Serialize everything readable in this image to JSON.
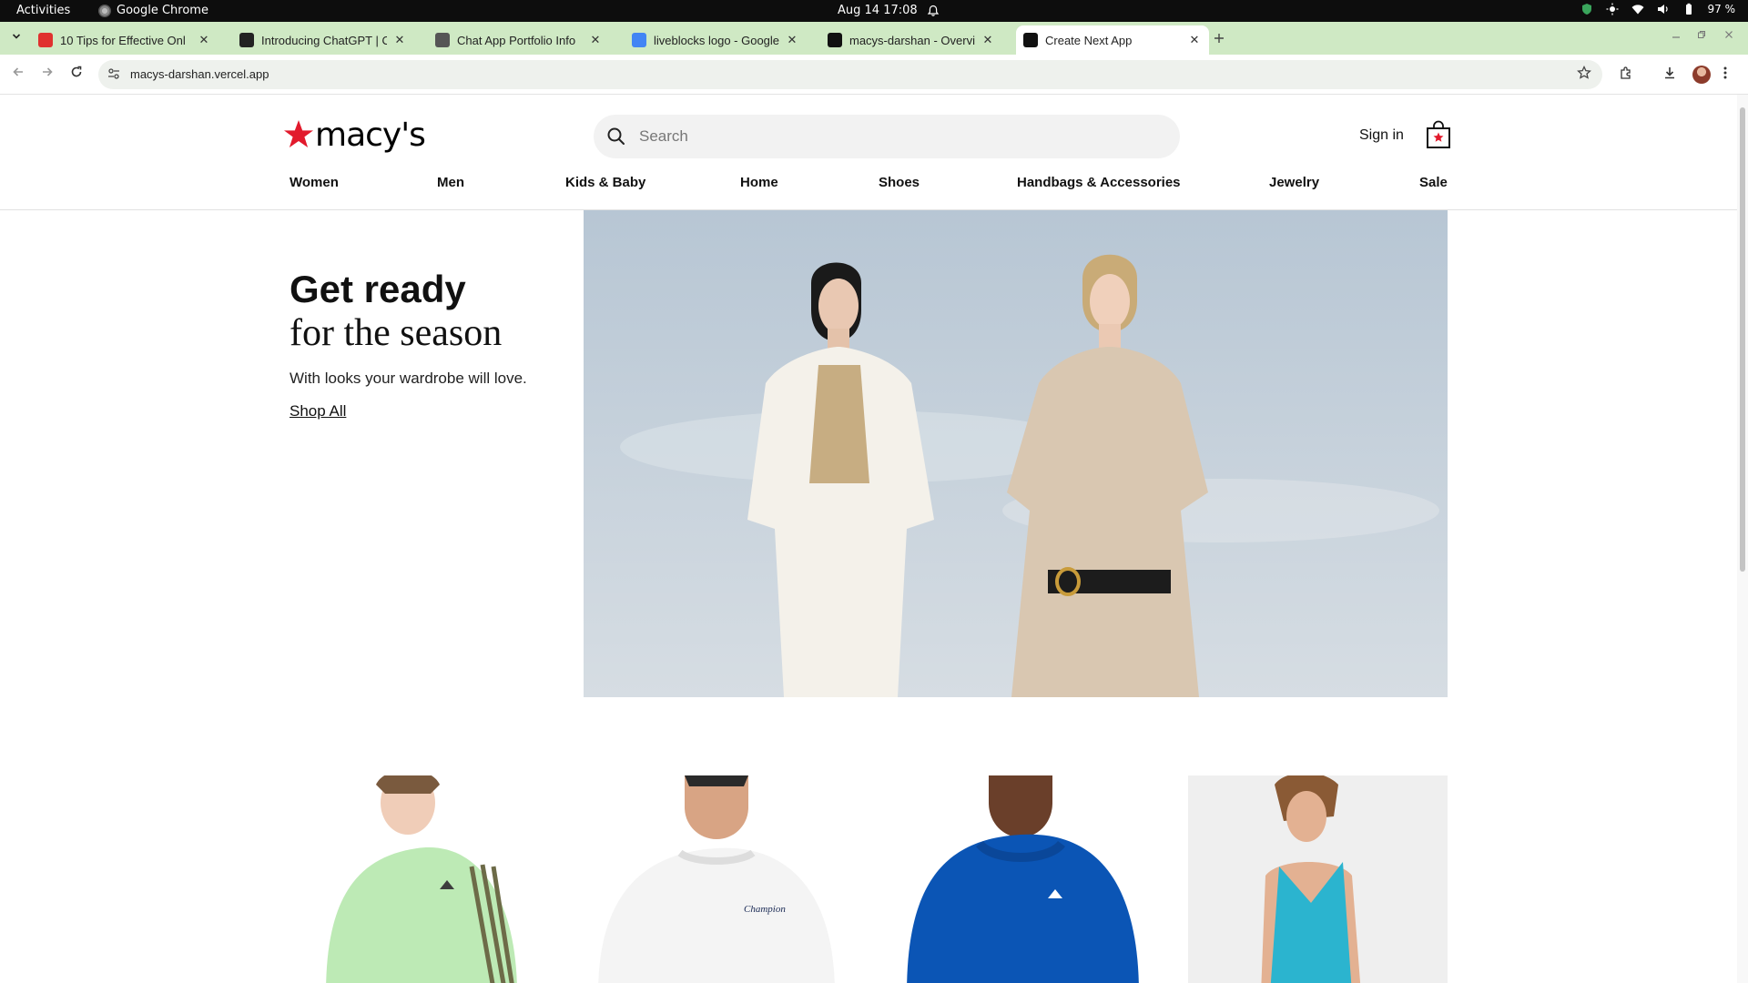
{
  "system_bar": {
    "activities": "Activities",
    "app_name": "Google Chrome",
    "clock": "Aug 14  17:08",
    "battery": "97 %"
  },
  "browser": {
    "tabs": [
      {
        "title": "10 Tips for Effective Onl",
        "favicon_color": "#e0312f"
      },
      {
        "title": "Introducing ChatGPT | O",
        "favicon_color": "#222222"
      },
      {
        "title": "Chat App Portfolio Info",
        "favicon_color": "#555555"
      },
      {
        "title": "liveblocks logo - Google",
        "favicon_color": "#4285f4"
      },
      {
        "title": "macys-darshan - Overvie",
        "favicon_color": "#111111"
      },
      {
        "title": "Create Next App",
        "favicon_color": "#111111"
      }
    ],
    "active_tab_index": 5,
    "url": "macys-darshan.vercel.app",
    "tabstrip_color": "#cfe9c4"
  },
  "header": {
    "logo_text": "macy's",
    "brand_color": "#e21a2c",
    "search_placeholder": "Search",
    "signin_label": "Sign in"
  },
  "nav": {
    "items": [
      "Women",
      "Men",
      "Kids & Baby",
      "Home",
      "Shoes",
      "Handbags & Accessories",
      "Jewelry",
      "Sale"
    ]
  },
  "hero": {
    "title": "Get ready",
    "subtitle": "for the season",
    "description": "With looks your wardrobe will love.",
    "cta": "Shop All"
  },
  "products": [
    {
      "item": "green-hoodie",
      "color": "#bdeab5"
    },
    {
      "item": "white-sweatshirt",
      "color": "#f3f3f3"
    },
    {
      "item": "blue-hoodie",
      "color": "#0b55b5"
    },
    {
      "item": "turquoise-halter-dress",
      "color": "#2bb4cf"
    }
  ]
}
